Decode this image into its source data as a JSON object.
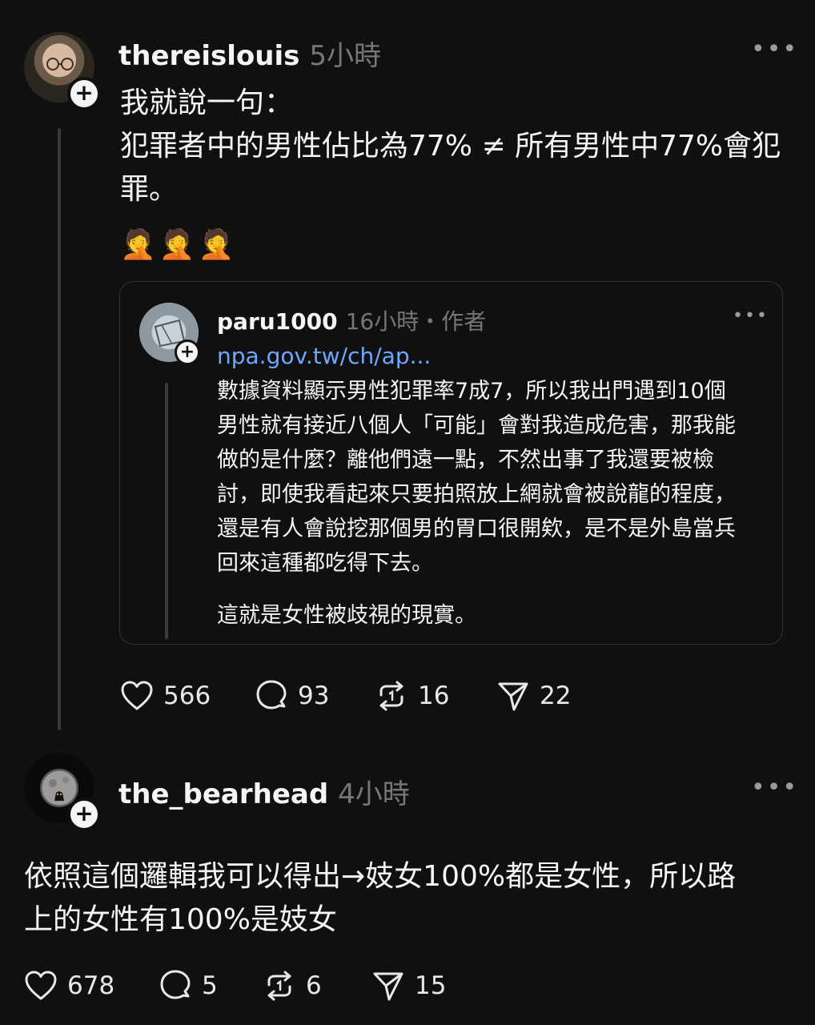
{
  "post1": {
    "username": "thereislouis",
    "time": "5小時",
    "more": "•••",
    "text_lines": [
      "我就說一句：",
      "犯罪者中的男性佔比為77% ≠ 所有男性中77%會犯",
      "罪。"
    ],
    "emoji": "🤦🤦🤦",
    "quote": {
      "username": "paru1000",
      "time": "16小時・作者",
      "more": "•••",
      "link": "npa.gov.tw/ch/ap...",
      "text_lines": [
        "數據資料顯示男性犯罪率7成7，所以我出門遇到10個",
        "男性就有接近八個人「可能」會對我造成危害，那我能",
        "做的是什麼？離他們遠一點，不然出事了我還要被檢",
        "討，即使我看起來只要拍照放上網就會被說龍的程度，",
        "還是有人會說挖那個男的胃口很開欸，是不是外島當兵",
        "回來這種都吃得下去。"
      ],
      "text_last": "這就是女性被歧視的現實。"
    },
    "actions": {
      "likes": "566",
      "comments": "93",
      "reposts": "16",
      "shares": "22"
    }
  },
  "post2": {
    "username": "the_bearhead",
    "time": "4小時",
    "more": "•••",
    "text_lines": [
      "依照這個邏輯我可以得出→妓女100%都是女性，所以路",
      "上的女性有100%是妓女"
    ],
    "actions": {
      "likes": "678",
      "comments": "5",
      "reposts": "6",
      "shares": "15"
    }
  },
  "icons": {
    "follow": "plus-icon",
    "like": "heart-icon",
    "comment": "comment-icon",
    "repost": "repost-icon",
    "share": "send-icon"
  },
  "colors": {
    "background": "#101010",
    "text": "#f3f5f7",
    "muted": "#777777",
    "link": "#6ea8fe"
  }
}
